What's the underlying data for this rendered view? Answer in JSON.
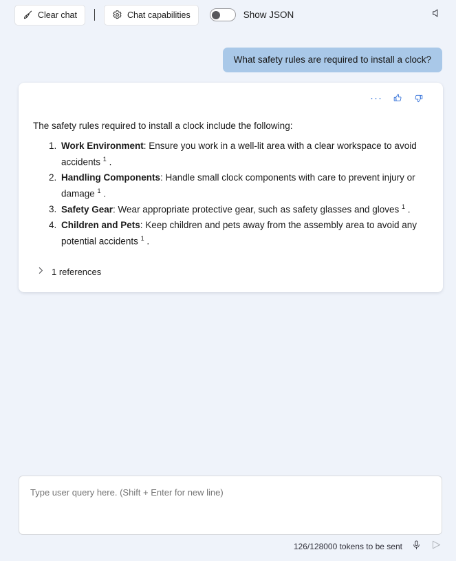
{
  "toolbar": {
    "clear_chat_label": "Clear chat",
    "clear_chat_icon": "broom-icon",
    "chat_capabilities_label": "Chat capabilities",
    "chat_capabilities_icon": "gear-icon",
    "show_json_label": "Show JSON",
    "show_json_state": "off",
    "speaker_icon": "speaker-mute-icon"
  },
  "conversation": {
    "user_message": "What safety rules are required to install a clock?",
    "response": {
      "actions": {
        "more_icon": "ellipsis-icon",
        "more_label": "···",
        "thumbs_up_icon": "thumbs-up-icon",
        "thumbs_down_icon": "thumbs-down-icon"
      },
      "intro": "The safety rules required to install a clock include the following:",
      "items": [
        {
          "title": "Work Environment",
          "text": ": Ensure you work in a well-lit area with a clear workspace to avoid accidents ",
          "citation": "1",
          "tail": " ."
        },
        {
          "title": "Handling Components",
          "text": ": Handle small clock components with care to prevent injury or damage ",
          "citation": "1",
          "tail": " ."
        },
        {
          "title": "Safety Gear",
          "text": ": Wear appropriate protective gear, such as safety glasses and gloves ",
          "citation": "1",
          "tail": " ."
        },
        {
          "title": "Children and Pets",
          "text": ": Keep children and pets away from the assembly area to avoid any potential accidents ",
          "citation": "1",
          "tail": " ."
        }
      ],
      "references_label": "1 references",
      "references_expanded": false,
      "references_icon": "chevron-right-icon"
    }
  },
  "composer": {
    "placeholder": "Type user query here. (Shift + Enter for new line)",
    "value": ""
  },
  "statusbar": {
    "token_text": "126/128000 tokens to be sent",
    "mic_icon": "microphone-icon",
    "send_icon": "send-arrow-icon"
  },
  "colors": {
    "page_background": "#eff3fa",
    "user_bubble": "#a9c8e8",
    "card_background": "#ffffff",
    "accent": "#2e6dd8",
    "text": "#1a1a1a"
  }
}
